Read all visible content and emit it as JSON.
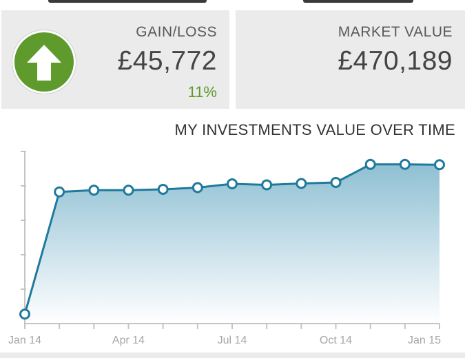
{
  "summary": {
    "gain_label": "GAIN/LOSS",
    "gain_value": "£45,772",
    "gain_percent": "11%",
    "market_label": "MARKET VALUE",
    "market_value": "£470,189",
    "trend_icon": "up-arrow-icon",
    "positive_color": "#5e9a2c"
  },
  "chart_data": {
    "type": "area",
    "title": "MY INVESTMENTS VALUE OVER TIME",
    "x_ticks": [
      "Jan 14",
      "Apr 14",
      "Jul 14",
      "Oct 14",
      "Jan 15"
    ],
    "x_tick_positions": [
      0,
      3,
      6,
      9,
      12
    ],
    "values": [
      0.055,
      0.765,
      0.775,
      0.775,
      0.78,
      0.79,
      0.812,
      0.806,
      0.814,
      0.82,
      0.925,
      0.925,
      0.923
    ],
    "ylim": [
      0,
      1
    ],
    "y_tick_count": 5,
    "grid": false,
    "line_color": "#1f7a9c",
    "fill_top_color": "#8fc0d3",
    "fill_bottom_color": "#ffffff"
  }
}
